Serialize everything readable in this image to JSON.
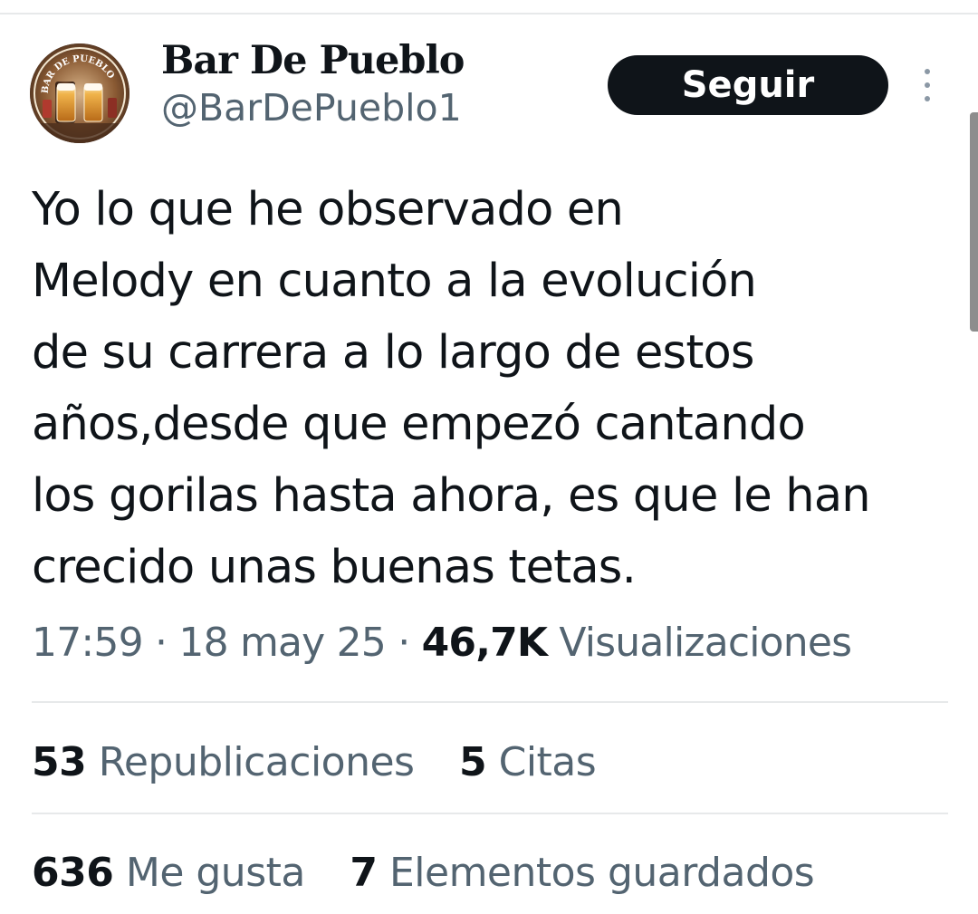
{
  "author": {
    "display_name": "Bar De Pueblo",
    "handle": "@BarDePueblo1",
    "avatar_text": "BAR DE PUEBLO"
  },
  "follow_button_label": "Seguir",
  "more_icon": "more-vertical-icon",
  "tweet": {
    "lines": [
      "Yo lo que he observado en",
      "Melody en cuanto a la evolución",
      "de su carrera a lo largo de estos",
      "años,desde que empezó cantando",
      "los gorilas hasta ahora, es que le han",
      "crecido unas buenas tetas."
    ]
  },
  "meta": {
    "time": "17:59",
    "separator": "·",
    "date": "18 may 25",
    "views_count": "46,7K",
    "views_label": "Visualizaciones"
  },
  "stats": {
    "reposts_count": "53",
    "reposts_label": "Republicaciones",
    "quotes_count": "5",
    "quotes_label": "Citas",
    "likes_count": "636",
    "likes_label": "Me gusta",
    "bookmarks_count": "7",
    "bookmarks_label": "Elementos guardados"
  },
  "colors": {
    "text_primary": "#0f1419",
    "text_secondary": "#536471",
    "button_bg": "#0f1419",
    "button_text": "#ffffff",
    "divider": "#e7e9ea"
  }
}
